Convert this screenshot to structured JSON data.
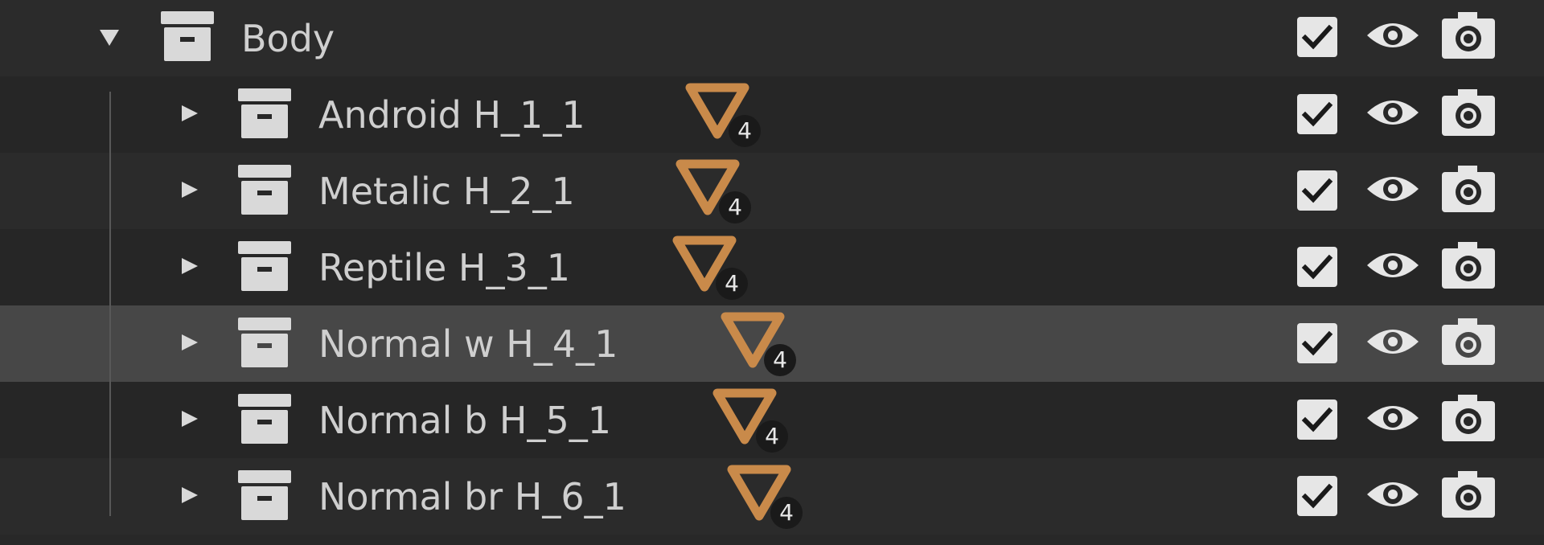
{
  "outliner": {
    "parent": {
      "label": "Body",
      "expanded": true,
      "icon": "collection-icon",
      "controls": {
        "exclude_checkbox": "checked",
        "visibility": "eye-icon",
        "render": "camera-icon"
      }
    },
    "children": [
      {
        "label": "Android H_1_1",
        "mesh_count": "4",
        "selected": false
      },
      {
        "label": "Metalic H_2_1",
        "mesh_count": "4",
        "selected": false
      },
      {
        "label": "Reptile H_3_1",
        "mesh_count": "4",
        "selected": false
      },
      {
        "label": "Normal w H_4_1",
        "mesh_count": "4",
        "selected": true
      },
      {
        "label": "Normal b H_5_1",
        "mesh_count": "4",
        "selected": false
      },
      {
        "label": "Normal br H_6_1",
        "mesh_count": "4",
        "selected": false
      }
    ],
    "icons": {
      "expand": "triangle-down-icon",
      "collapse": "triangle-right-icon",
      "collection": "collection-icon",
      "mesh": "mesh-triangle-icon",
      "checkbox": "checkbox-checked-icon",
      "eye": "eye-icon",
      "camera": "camera-icon"
    },
    "colors": {
      "background": "#282828",
      "selected_row": "#474747",
      "text": "#cfcfcf",
      "icon_light": "#d9d9d9",
      "mesh_accent": "#c98a4a"
    }
  }
}
